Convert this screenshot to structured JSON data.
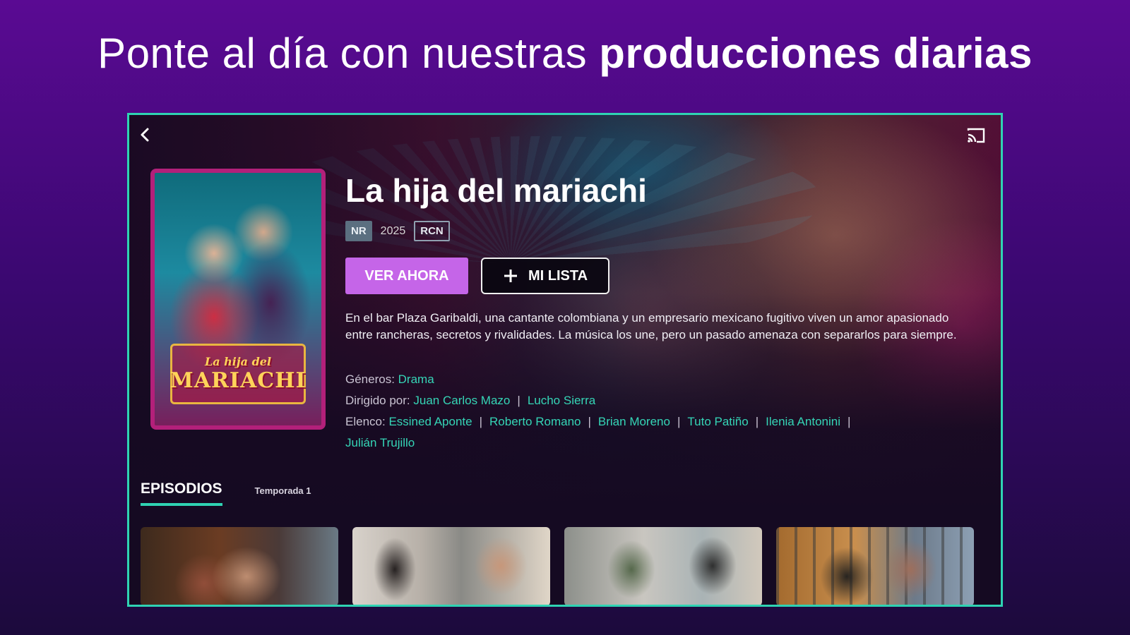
{
  "headline": {
    "regular": "Ponte al día con nuestras ",
    "bold": "producciones diarias"
  },
  "show": {
    "title": "La hija del mariachi",
    "rating": "NR",
    "year": "2025",
    "channel": "RCN",
    "poster_title_line1": "La hija del",
    "poster_title_line2": "MARIACHI",
    "synopsis": "En el bar Plaza Garibaldi, una cantante colombiana y un empresario mexicano fugitivo viven un amor apasionado entre rancheras, secretos y rivalidades. La música los une, pero un pasado amenaza con separarlos para siempre."
  },
  "actions": {
    "watch_label": "VER AHORA",
    "list_label": "MI LISTA"
  },
  "credits": {
    "genres_label": "Géneros: ",
    "genres": [
      "Drama"
    ],
    "directed_label": "Dirigido por: ",
    "directors": [
      "Juan Carlos Mazo",
      "Lucho Sierra"
    ],
    "cast_label": "Elenco: ",
    "cast": [
      "Essined Aponte",
      "Roberto Romano",
      "Brian Moreno",
      "Tuto Patiño",
      "Ilenia Antonini",
      "Julián Trujillo"
    ],
    "separator": "|"
  },
  "episodes": {
    "tab_label": "EPISODIOS",
    "season_label": "Temporada 1"
  },
  "colors": {
    "accent": "#2fd3b3",
    "watch_button": "#c565e8",
    "link": "#35d5b6"
  },
  "icons": {
    "back": "chevron-left-icon",
    "cast": "cast-icon",
    "add": "plus-icon"
  }
}
